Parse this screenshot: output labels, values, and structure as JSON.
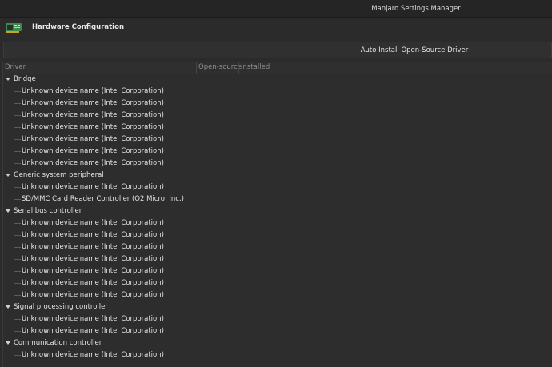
{
  "window": {
    "title": "Manjaro Settings Manager"
  },
  "header": {
    "icon": "graphics-card-icon",
    "title": "Hardware Configuration"
  },
  "actions": {
    "auto_install_label": "Auto Install Open-Source Driver"
  },
  "table": {
    "columns": [
      "Driver",
      "Open-source",
      "Installed"
    ],
    "groups": [
      {
        "name": "Bridge",
        "items": [
          "Unknown device name (Intel Corporation)",
          "Unknown device name (Intel Corporation)",
          "Unknown device name (Intel Corporation)",
          "Unknown device name (Intel Corporation)",
          "Unknown device name (Intel Corporation)",
          "Unknown device name (Intel Corporation)",
          "Unknown device name (Intel Corporation)"
        ]
      },
      {
        "name": "Generic system peripheral",
        "items": [
          "Unknown device name (Intel Corporation)",
          "SD/MMC Card Reader Controller (O2 Micro, Inc.)"
        ]
      },
      {
        "name": "Serial bus controller",
        "items": [
          "Unknown device name (Intel Corporation)",
          "Unknown device name (Intel Corporation)",
          "Unknown device name (Intel Corporation)",
          "Unknown device name (Intel Corporation)",
          "Unknown device name (Intel Corporation)",
          "Unknown device name (Intel Corporation)",
          "Unknown device name (Intel Corporation)"
        ]
      },
      {
        "name": "Signal processing controller",
        "items": [
          "Unknown device name (Intel Corporation)",
          "Unknown device name (Intel Corporation)"
        ]
      },
      {
        "name": "Communication controller",
        "items": [
          "Unknown device name (Intel Corporation)"
        ]
      }
    ]
  }
}
